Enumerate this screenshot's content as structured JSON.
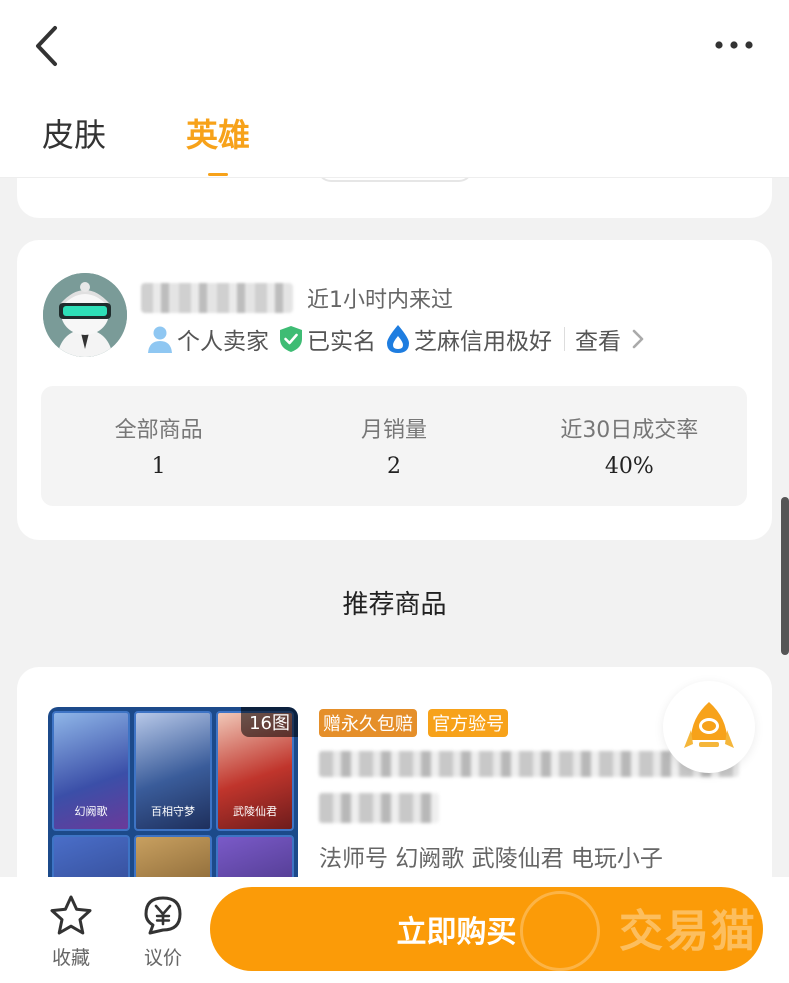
{
  "header": {
    "tabs": [
      {
        "label": "皮肤",
        "active": false
      },
      {
        "label": "英雄",
        "active": true
      }
    ]
  },
  "seller": {
    "last_seen": "近1小时内来过",
    "badges": [
      {
        "icon": "person-icon",
        "label": "个人卖家"
      },
      {
        "icon": "verified-shield-icon",
        "label": "已实名"
      },
      {
        "icon": "sesame-credit-icon",
        "label": "芝麻信用极好"
      }
    ],
    "view_label": "查看",
    "stats": [
      {
        "label": "全部商品",
        "value": "1"
      },
      {
        "label": "月销量",
        "value": "2"
      },
      {
        "label": "近30日成交率",
        "value": "40%"
      }
    ]
  },
  "recommend": {
    "title": "推荐商品"
  },
  "product": {
    "photo_count": "16图",
    "tags": [
      "赠永久包赔",
      "官方验号"
    ],
    "keywords": "法师号 幻阙歌 武陵仙君 电玩小子",
    "thumb_heroes": [
      "幻阙歌",
      "百相守梦",
      "武陵仙君"
    ]
  },
  "bottom_bar": {
    "favorite_label": "收藏",
    "bargain_label": "议价",
    "buy_label": "立即购买",
    "watermark": "交易猫"
  },
  "colors": {
    "accent": "#f7a21a",
    "buy_button": "#fb9b08",
    "page_bg": "#f2f2f2"
  }
}
